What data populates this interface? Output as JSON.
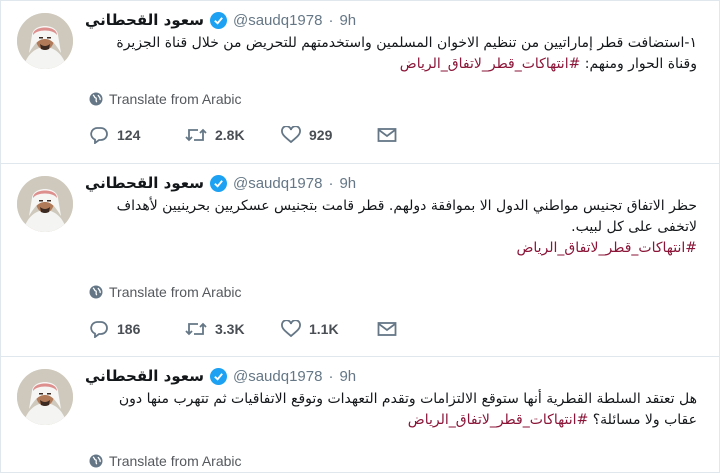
{
  "tweets": [
    {
      "author": "سعود القحطاني",
      "handle": "@saudq1978",
      "separator": "·",
      "time": "9h",
      "text": "١-استضافت قطر إماراتيين من تنظيم الاخوان المسلمين واستخدمتهم للتحريض من خلال قناة الجزيرة وقناة الحوار ومنهم: ",
      "hashtag": "#انتهاكات_قطر_لاتفاق_الرياض",
      "translate": "Translate from Arabic",
      "replies": "124",
      "retweets": "2.8K",
      "likes": "929"
    },
    {
      "author": "سعود القحطاني",
      "handle": "@saudq1978",
      "separator": "·",
      "time": "9h",
      "text": "حظر الاتفاق تجنيس مواطني الدول الا بموافقة دولهم. قطر قامت بتجنيس عسكريين بحرينيين لأهداف لاتخفى على كل لبيب.",
      "hashtag": "#انتهاكات_قطر_لاتفاق_الرياض",
      "translate": "Translate from Arabic",
      "replies": "186",
      "retweets": "3.3K",
      "likes": "1.1K"
    },
    {
      "author": "سعود القحطاني",
      "handle": "@saudq1978",
      "separator": "·",
      "time": "9h",
      "text": "هل تعتقد السلطة القطرية أنها ستوقع الالتزامات وتقدم التعهدات وتوقع الاتفاقيات ثم تتهرب منها دون عقاب ولا مسائلة؟ ",
      "hashtag": "#انتهاكات_قطر_لاتفاق_الرياض",
      "translate": "Translate from Arabic"
    }
  ],
  "colors": {
    "hashtag": "#8a1538",
    "verified": "#1da1f2",
    "secondary_text": "#657786",
    "border": "#e1e8ed"
  },
  "icons": [
    "avatar",
    "verified-badge-icon",
    "globe-icon",
    "reply-icon",
    "retweet-icon",
    "like-icon",
    "message-icon"
  ]
}
